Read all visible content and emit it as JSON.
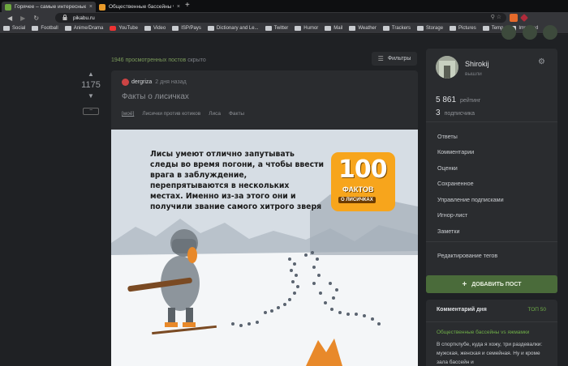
{
  "browser": {
    "tabs": [
      {
        "label": "Горячее – самые интересные",
        "close": "×"
      },
      {
        "label": "Общественные бассейны vs яжм...",
        "close": "×"
      }
    ],
    "new_tab": "+",
    "url": "pikabu.ru",
    "bookmarks": [
      "Social",
      "Football",
      "Anime/Drama",
      "YouTube",
      "Video",
      "ISP/Pays",
      "Dictionary and Le...",
      "Twitter",
      "Humor",
      "Mail",
      "Weather",
      "Trackers",
      "Storage",
      "Pictures",
      "Temp",
      "Imported"
    ]
  },
  "feed": {
    "hidden_count": "1946 просмотренных постов",
    "hidden_suffix": "скрыто",
    "filters_label": "Фильтры"
  },
  "post": {
    "rating": "1175",
    "collapse": "−",
    "author": "dergriza",
    "time": "2 дня назад",
    "title": "Факты о лисичках",
    "tags": [
      "[моё]",
      "Лисички против котиков",
      "Лиса",
      "Факты"
    ],
    "image_text": "Лисы умеют отлично запутывать следы во время погони, а чтобы ввести врага в заблуждение, перепрятываются в нескольких местах. Именно из-за этого они и получили звание самого хитрого зверя",
    "badge_number": "100",
    "badge_word": "ФАКТОВ",
    "badge_sub": "О ЛИСИЧКАХ"
  },
  "profile": {
    "username": "Shirokij",
    "status": "вышли",
    "rating_value": "5 861",
    "rating_label": "рейтинг",
    "subs_value": "3",
    "subs_label": "подписчика",
    "menu": [
      "Ответы",
      "Комментарии",
      "Оценки",
      "Сохраненное",
      "Управление подписками",
      "Игнор-лист",
      "Заметки",
      "Редактирование тегов"
    ]
  },
  "add_post": "ДОБАВИТЬ ПОСТ",
  "comment_day": {
    "title": "Комментарий дня",
    "top": "ТОП 50",
    "link": "Общественные бассейны vs яжмамки",
    "body": "В спортклубе, куда я хожу, три раздевалки: мужская, женская и семейная. Ну и кроме зала бассейн и"
  }
}
